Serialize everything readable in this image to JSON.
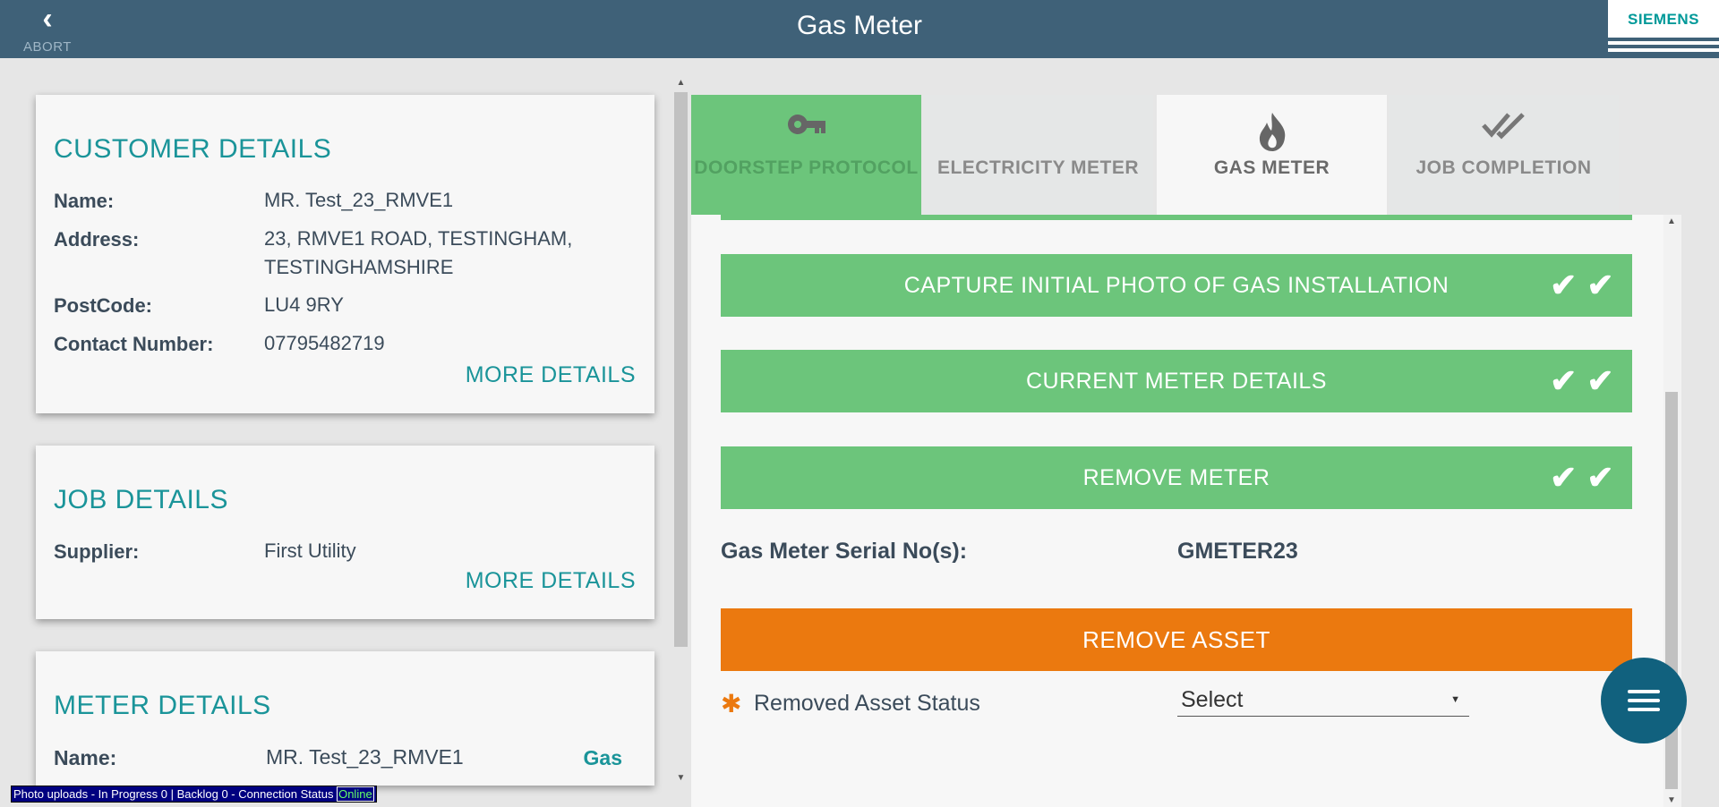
{
  "header": {
    "back_label": "ABORT",
    "title": "Gas Meter",
    "logo": "SIEMENS"
  },
  "customer": {
    "heading": "CUSTOMER DETAILS",
    "name_label": "Name:",
    "name": "MR. Test_23_RMVE1",
    "address_label": "Address:",
    "address": "23, RMVE1 ROAD, TESTINGHAM, TESTINGHAMSHIRE",
    "postcode_label": "PostCode:",
    "postcode": "LU4 9RY",
    "contact_label": "Contact Number:",
    "contact": "07795482719",
    "more": "MORE DETAILS"
  },
  "job": {
    "heading": "JOB DETAILS",
    "supplier_label": "Supplier:",
    "supplier": "First Utility",
    "more": "MORE DETAILS"
  },
  "meter": {
    "heading": "METER DETAILS",
    "name_label": "Name:",
    "name": "MR. Test_23_RMVE1",
    "type": "Gas"
  },
  "tabs": [
    {
      "label": "DOORSTEP PROTOCOL",
      "icon": "key-icon"
    },
    {
      "label": "ELECTRICITY METER",
      "icon": "none"
    },
    {
      "label": "GAS METER",
      "icon": "flame-icon"
    },
    {
      "label": "JOB COMPLETION",
      "icon": "double-check-icon"
    }
  ],
  "sections": {
    "capture_photo": "CAPTURE INITIAL PHOTO OF GAS INSTALLATION",
    "current_meter": "CURRENT METER DETAILS",
    "remove_meter": "REMOVE METER"
  },
  "form": {
    "serial_label": "Gas Meter Serial No(s):",
    "serial_value": "GMETER23",
    "remove_asset": "REMOVE ASSET",
    "required_marker": "✱",
    "removed_status_label": "Removed Asset Status",
    "removed_status_value": "Select"
  },
  "status_bar": {
    "text": "Photo uploads - In Progress 0 | Backlog 0 - Connection Status",
    "connection": "Online"
  },
  "colors": {
    "header": "#3f6178",
    "accent_teal": "#1a9499",
    "success_green": "#6cc57b",
    "action_orange": "#eb790f",
    "fab_blue": "#11617e"
  }
}
